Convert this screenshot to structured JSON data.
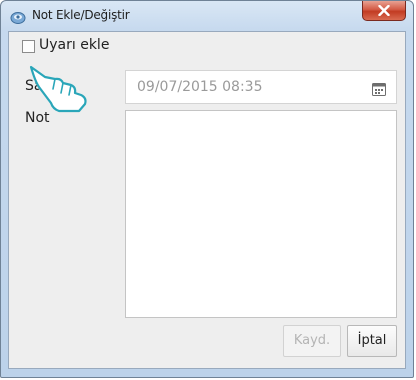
{
  "window": {
    "title": "Not Ekle/Değiştir",
    "close_symbol": "X"
  },
  "form": {
    "alert_checkbox": {
      "label": "Uyarı ekle",
      "checked": false
    },
    "date_label": "Saat",
    "date_value": "09/07/2015 08:35",
    "note_label": "Not",
    "note_value": ""
  },
  "buttons": {
    "save_label": "Kayd.",
    "save_enabled": false,
    "cancel_label": "İptal"
  },
  "icons": {
    "app": "window-app-icon",
    "close": "close-icon",
    "calendar": "calendar-icon",
    "cursor": "hand-pointer-cursor"
  },
  "colors": {
    "close_button": "#c23b22",
    "title_gradient_top": "#d9e7f5",
    "disabled_text": "#b4b4b4"
  }
}
